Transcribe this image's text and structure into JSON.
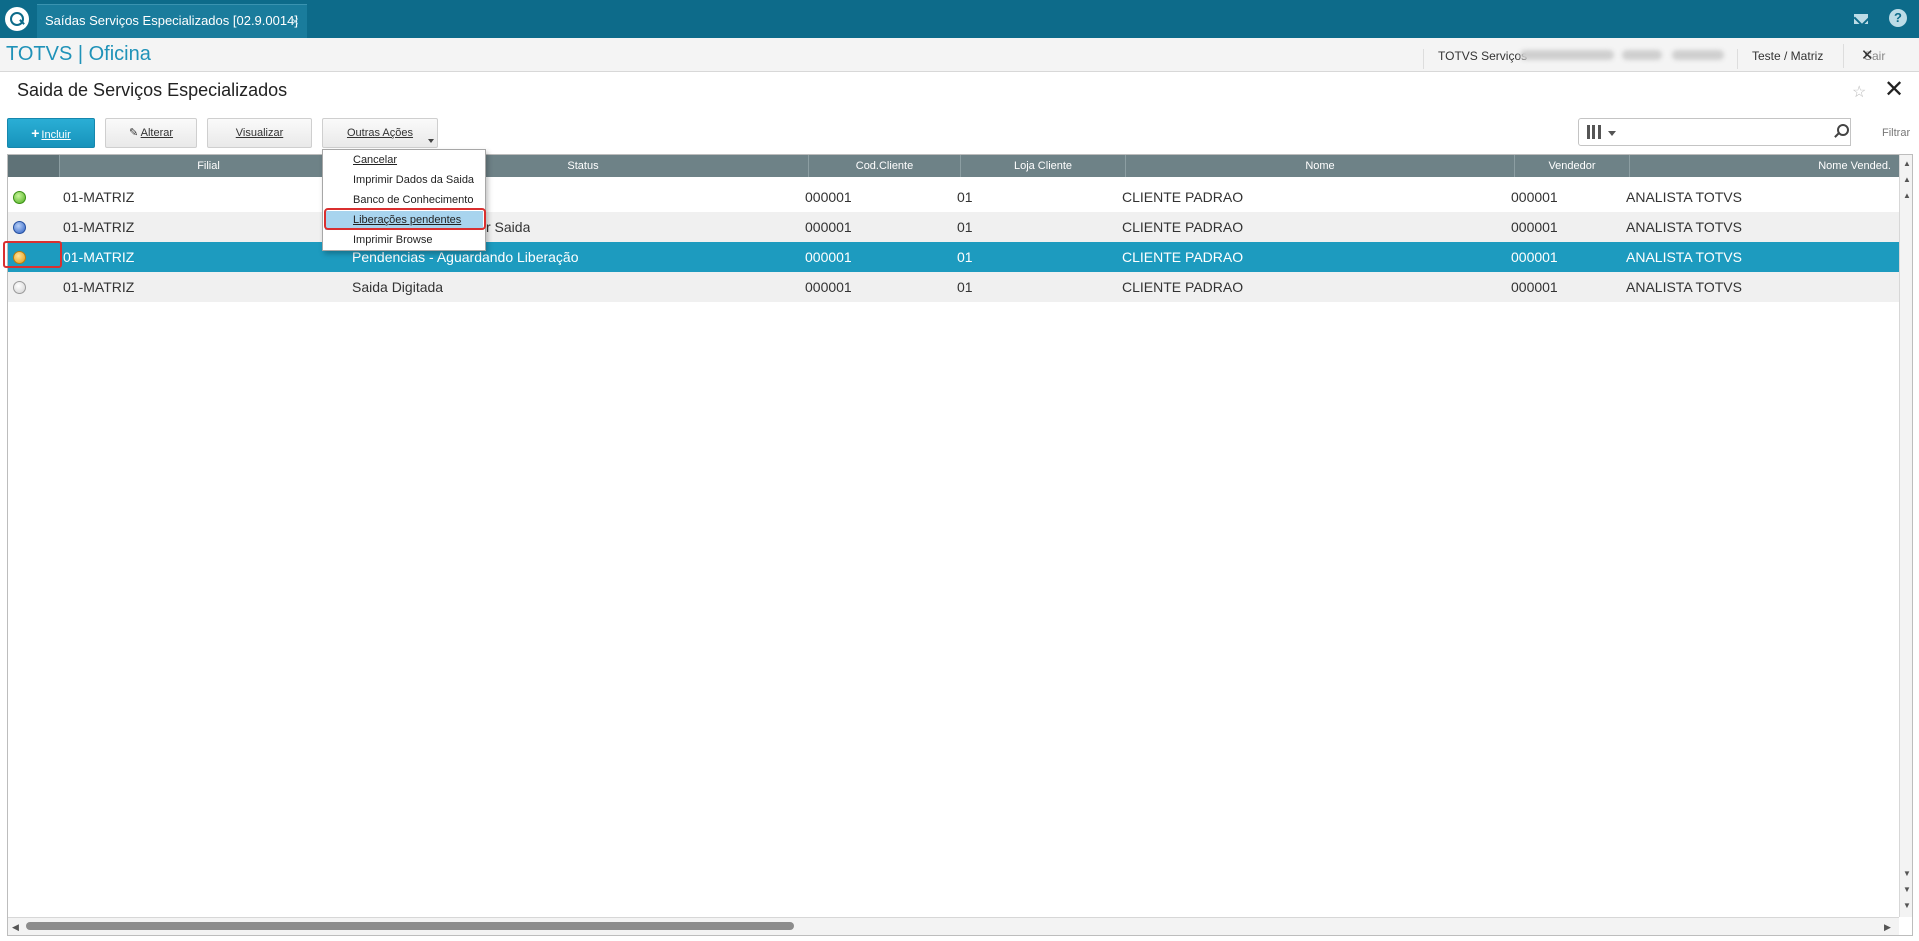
{
  "window": {
    "tab_title": "Saídas Serviços Especializados [02.9.0014]",
    "tab_close": "×"
  },
  "topbar": {
    "product": "TOTVS | Oficina",
    "company": "TOTVS Serviços",
    "branch": "Teste / Matriz",
    "sair_label": "Sair",
    "sair_icon": "✕"
  },
  "page": {
    "title": "Saida de Serviços Especializados",
    "favorite_icon": "☆",
    "close_icon": "✕"
  },
  "toolbar": {
    "incluir_plus": "+",
    "incluir": "Incluir",
    "alterar_icon": "✎",
    "alterar": "Alterar",
    "visualizar": "Visualizar",
    "outras_acoes": "Outras Ações"
  },
  "search": {
    "value": "",
    "filtrar": "Filtrar"
  },
  "menu": {
    "items": [
      {
        "label": "Cancelar"
      },
      {
        "label": "Imprimir Dados da Saida"
      },
      {
        "label": "Banco de Conhecimento"
      },
      {
        "label": "Liberações pendentes",
        "active": true
      },
      {
        "label": "Imprimir Browse"
      }
    ]
  },
  "grid": {
    "columns": [
      "",
      "Filial",
      "Status",
      "Cod.Cliente",
      "Loja Cliente",
      "Nome",
      "Vendedor",
      "Nome Vended."
    ],
    "rows": [
      {
        "legend_color": "green",
        "filial": "01-MATRIZ",
        "status": "",
        "cod_cliente": "000001",
        "loja": "01",
        "nome": "CLIENTE PADRAO",
        "vendedor": "000001",
        "nome_vendedor": "ANALISTA TOTVS"
      },
      {
        "legend_color": "blue",
        "filial": "01-MATRIZ",
        "status": "r Saida",
        "cod_cliente": "000001",
        "loja": "01",
        "nome": "CLIENTE PADRAO",
        "vendedor": "000001",
        "nome_vendedor": "ANALISTA TOTVS"
      },
      {
        "legend_color": "orange",
        "filial": "01-MATRIZ",
        "status": "Pendencias - Aguardando Liberação",
        "cod_cliente": "000001",
        "loja": "01",
        "nome": "CLIENTE PADRAO",
        "vendedor": "000001",
        "nome_vendedor": "ANALISTA TOTVS",
        "selected": true
      },
      {
        "legend_color": "white",
        "filial": "01-MATRIZ",
        "status": "Saida Digitada",
        "cod_cliente": "000001",
        "loja": "01",
        "nome": "CLIENTE PADRAO",
        "vendedor": "000001",
        "nome_vendedor": "ANALISTA TOTVS"
      }
    ]
  },
  "colors": {
    "accent": "#1d9bbf",
    "titlebar": "#0d6b8a",
    "highlight_box": "#d92f2f"
  }
}
